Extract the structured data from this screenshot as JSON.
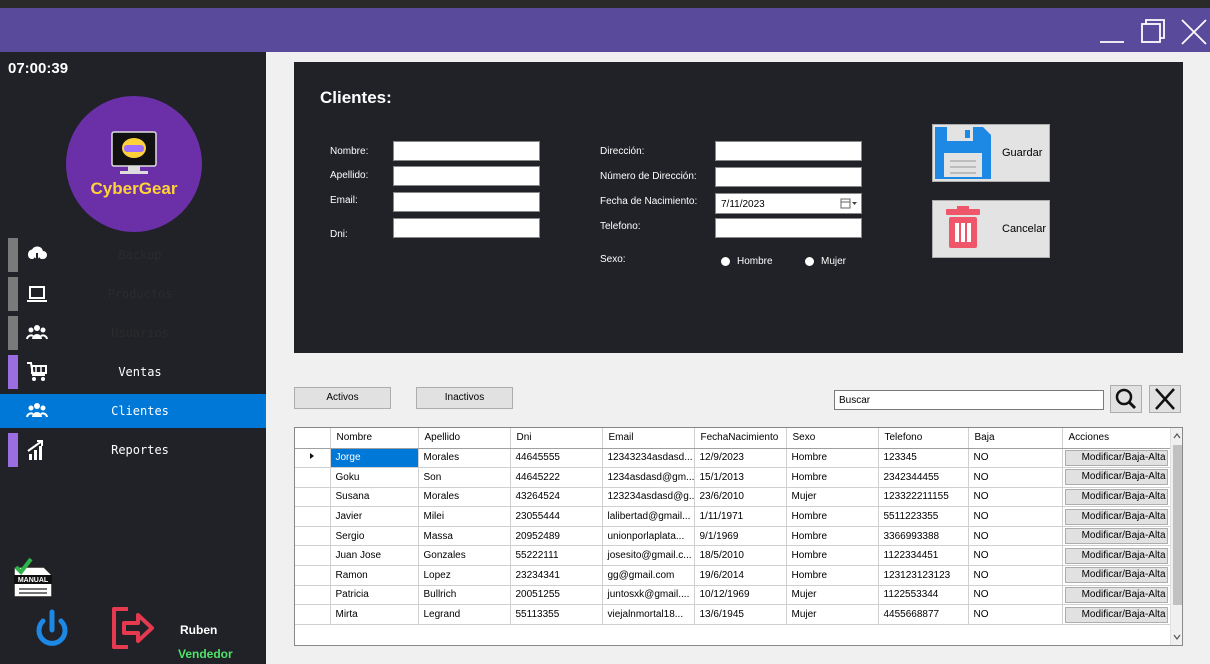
{
  "clock": "07:00:39",
  "logo": {
    "text": "CyberGear"
  },
  "nav": [
    {
      "label": "Backup",
      "icon": "cloud-download-icon",
      "dim": true,
      "accent": false
    },
    {
      "label": "Productos",
      "icon": "laptop-icon",
      "dim": true,
      "accent": false
    },
    {
      "label": "Usuarios",
      "icon": "users-icon",
      "dim": true,
      "accent": false
    },
    {
      "label": "Ventas",
      "icon": "cart-icon",
      "dim": false,
      "accent": true
    },
    {
      "label": "Clientes",
      "icon": "users-icon",
      "dim": false,
      "accent": true,
      "selected": true
    },
    {
      "label": "Reportes",
      "icon": "chart-icon",
      "dim": false,
      "accent": true
    }
  ],
  "user": {
    "name": "Ruben",
    "role": "Vendedor"
  },
  "manual": {
    "label": "MANUAL"
  },
  "form": {
    "title": "Clientes:",
    "labels": {
      "nombre": "Nombre:",
      "apellido": "Apellido:",
      "email": "Email:",
      "dni": "Dni:",
      "direccion": "Dirección:",
      "numero_direccion": "Número de Dirección:",
      "fecha_nacimiento": "Fecha de Nacimiento:",
      "telefono": "Telefono:",
      "sexo": "Sexo:"
    },
    "values": {
      "nombre": "",
      "apellido": "",
      "email": "",
      "dni": "",
      "direccion": "",
      "numero_direccion": "",
      "telefono": ""
    },
    "fecha_value": "7/11/2023",
    "sexo_options": [
      "Hombre",
      "Mujer"
    ],
    "guardar": "Guardar",
    "cancelar": "Cancelar"
  },
  "filters": {
    "activos": "Activos",
    "inactivos": "Inactivos"
  },
  "search": {
    "value": "Buscar"
  },
  "table": {
    "columns": [
      "Nombre",
      "Apellido",
      "Dni",
      "Email",
      "FechaNacimiento",
      "Sexo",
      "Telefono",
      "Baja",
      "Acciones"
    ],
    "action_label": "Modificar/Baja-Alta",
    "rows": [
      [
        "Jorge",
        "Morales",
        "44645555",
        "12343234asdasd...",
        "12/9/2023",
        "Hombre",
        "123345",
        "NO"
      ],
      [
        "Goku",
        "Son",
        "44645222",
        "1234asdasd@gm...",
        "15/1/2013",
        "Hombre",
        "2342344455",
        "NO"
      ],
      [
        "Susana",
        "Morales",
        "43264524",
        "123234asdasd@g...",
        "23/6/2010",
        "Mujer",
        "123322211155",
        "NO"
      ],
      [
        "Javier",
        "Milei",
        "23055444",
        "lalibertad@gmail...",
        "1/11/1971",
        "Hombre",
        "5511223355",
        "NO"
      ],
      [
        "Sergio",
        "Massa",
        "20952489",
        "unionporlaplata...",
        "9/1/1969",
        "Hombre",
        "3366993388",
        "NO"
      ],
      [
        "Juan Jose",
        "Gonzales",
        "55222111",
        "josesito@gmail.c...",
        "18/5/2010",
        "Hombre",
        "1122334451",
        "NO"
      ],
      [
        "Ramon",
        "Lopez",
        "23234341",
        "gg@gmail.com",
        "19/6/2014",
        "Hombre",
        "123123123123",
        "NO"
      ],
      [
        "Patricia",
        "Bullrich",
        "20051255",
        "juntosxk@gmail....",
        "10/12/1969",
        "Mujer",
        "1122553344",
        "NO"
      ],
      [
        "Mirta",
        "Legrand",
        "55113355",
        "viejalnmortal18...",
        "13/6/1945",
        "Mujer",
        "4455668877",
        "NO"
      ]
    ]
  },
  "colors": {
    "titlebar": "#5a4a9c",
    "sidebar": "#202228",
    "selected": "#0078d7",
    "accent": "#9a6ee0",
    "role": "#4ee36a",
    "logo": "#6b2fa8"
  }
}
